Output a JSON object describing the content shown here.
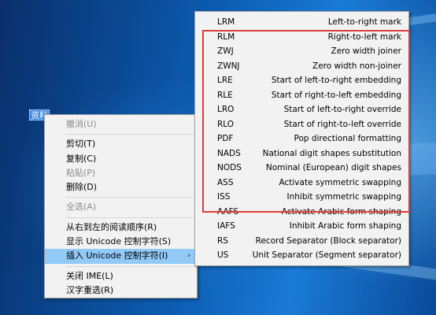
{
  "desktop": {
    "selected_text": "资料"
  },
  "context_menu": {
    "items": [
      {
        "label": "撤消(U)",
        "disabled": true
      },
      {
        "sep": true
      },
      {
        "label": "剪切(T)"
      },
      {
        "label": "复制(C)"
      },
      {
        "label": "粘贴(P)",
        "disabled": true
      },
      {
        "label": "删除(D)"
      },
      {
        "sep": true
      },
      {
        "label": "全选(A)",
        "disabled": true
      },
      {
        "sep": true
      },
      {
        "label": "从右到左的阅读顺序(R)"
      },
      {
        "label": "显示 Unicode 控制字符(S)"
      },
      {
        "label": "插入 Unicode 控制字符(I)",
        "highlight": true,
        "submenu": true,
        "arrow": "›"
      },
      {
        "sep": true
      },
      {
        "label": "关闭 IME(L)"
      },
      {
        "label": "汉字重选(R)"
      }
    ]
  },
  "unicode_submenu": {
    "items": [
      {
        "code": "LRM",
        "desc": "Left-to-right mark"
      },
      {
        "code": "RLM",
        "desc": "Right-to-left mark"
      },
      {
        "code": "ZWJ",
        "desc": "Zero width joiner"
      },
      {
        "code": "ZWNJ",
        "desc": "Zero width non-joiner"
      },
      {
        "code": "LRE",
        "desc": "Start of left-to-right embedding"
      },
      {
        "code": "RLE",
        "desc": "Start of right-to-left embedding"
      },
      {
        "code": "LRO",
        "desc": "Start of left-to-right override"
      },
      {
        "code": "RLO",
        "desc": "Start of right-to-left override"
      },
      {
        "code": "PDF",
        "desc": "Pop directional formatting"
      },
      {
        "code": "NADS",
        "desc": "National digit shapes substitution"
      },
      {
        "code": "NODS",
        "desc": "Nominal (European) digit shapes"
      },
      {
        "code": "ASS",
        "desc": "Activate symmetric swapping"
      },
      {
        "code": "ISS",
        "desc": "Inhibit symmetric swapping"
      },
      {
        "code": "AAFS",
        "desc": "Activate Arabic form shaping"
      },
      {
        "code": "IAFS",
        "desc": "Inhibit Arabic form shaping"
      },
      {
        "code": "RS",
        "desc": "Record Separator (Block separator)"
      },
      {
        "code": "US",
        "desc": "Unit Separator (Segment separator)"
      }
    ]
  },
  "colors": {
    "highlight_box": "#e03a3a",
    "menu_highlight": "#91c9f7",
    "menu_background": "#f2f2f2"
  }
}
